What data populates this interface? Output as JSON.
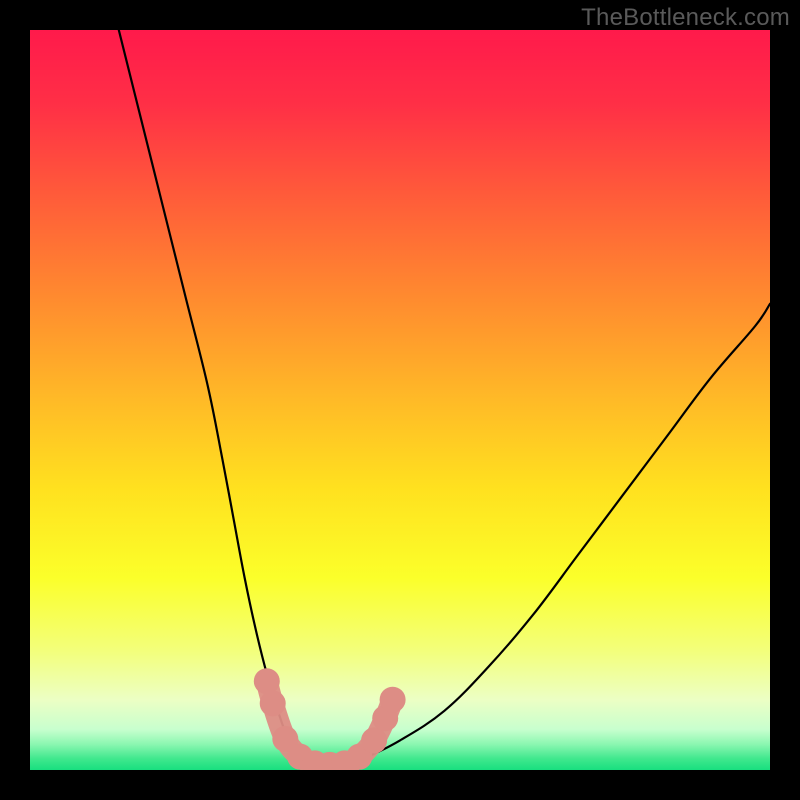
{
  "watermark": {
    "text": "TheBottleneck.com"
  },
  "gradient": {
    "stops": [
      {
        "offset": 0.0,
        "color": "#ff1a4b"
      },
      {
        "offset": 0.1,
        "color": "#ff2f46"
      },
      {
        "offset": 0.22,
        "color": "#ff5a3a"
      },
      {
        "offset": 0.36,
        "color": "#ff8a2f"
      },
      {
        "offset": 0.5,
        "color": "#ffba27"
      },
      {
        "offset": 0.62,
        "color": "#ffe11f"
      },
      {
        "offset": 0.74,
        "color": "#fbff2a"
      },
      {
        "offset": 0.84,
        "color": "#f3ff7c"
      },
      {
        "offset": 0.905,
        "color": "#ecffc4"
      },
      {
        "offset": 0.945,
        "color": "#c8ffce"
      },
      {
        "offset": 0.965,
        "color": "#8cf7b1"
      },
      {
        "offset": 0.985,
        "color": "#3fe88d"
      },
      {
        "offset": 1.0,
        "color": "#18df7f"
      }
    ]
  },
  "chart_data": {
    "type": "line",
    "title": "",
    "xlabel": "",
    "ylabel": "",
    "xlim": [
      0,
      100
    ],
    "ylim": [
      0,
      100
    ],
    "series": [
      {
        "name": "bottleneck-curve",
        "x": [
          12,
          15,
          18,
          21,
          24,
          26,
          27.5,
          29,
          30.5,
          32,
          33.5,
          35,
          37,
          39,
          42,
          45,
          50,
          56,
          62,
          68,
          74,
          80,
          86,
          92,
          98,
          100
        ],
        "y": [
          100,
          88,
          76,
          64,
          52,
          42,
          34,
          26,
          19,
          13,
          8,
          4,
          1.5,
          0.5,
          0.5,
          1.5,
          4,
          8,
          14,
          21,
          29,
          37,
          45,
          53,
          60,
          63
        ]
      }
    ],
    "markers": {
      "name": "optimum-band",
      "color": "#dd8d85",
      "points": [
        {
          "x": 32.0,
          "y": 12.0
        },
        {
          "x": 32.8,
          "y": 9.0
        },
        {
          "x": 34.5,
          "y": 4.2
        },
        {
          "x": 36.5,
          "y": 1.8
        },
        {
          "x": 38.5,
          "y": 0.9
        },
        {
          "x": 40.5,
          "y": 0.7
        },
        {
          "x": 42.5,
          "y": 0.9
        },
        {
          "x": 44.5,
          "y": 1.8
        },
        {
          "x": 46.5,
          "y": 4.0
        },
        {
          "x": 48.0,
          "y": 7.0
        },
        {
          "x": 49.0,
          "y": 9.5
        }
      ]
    }
  }
}
